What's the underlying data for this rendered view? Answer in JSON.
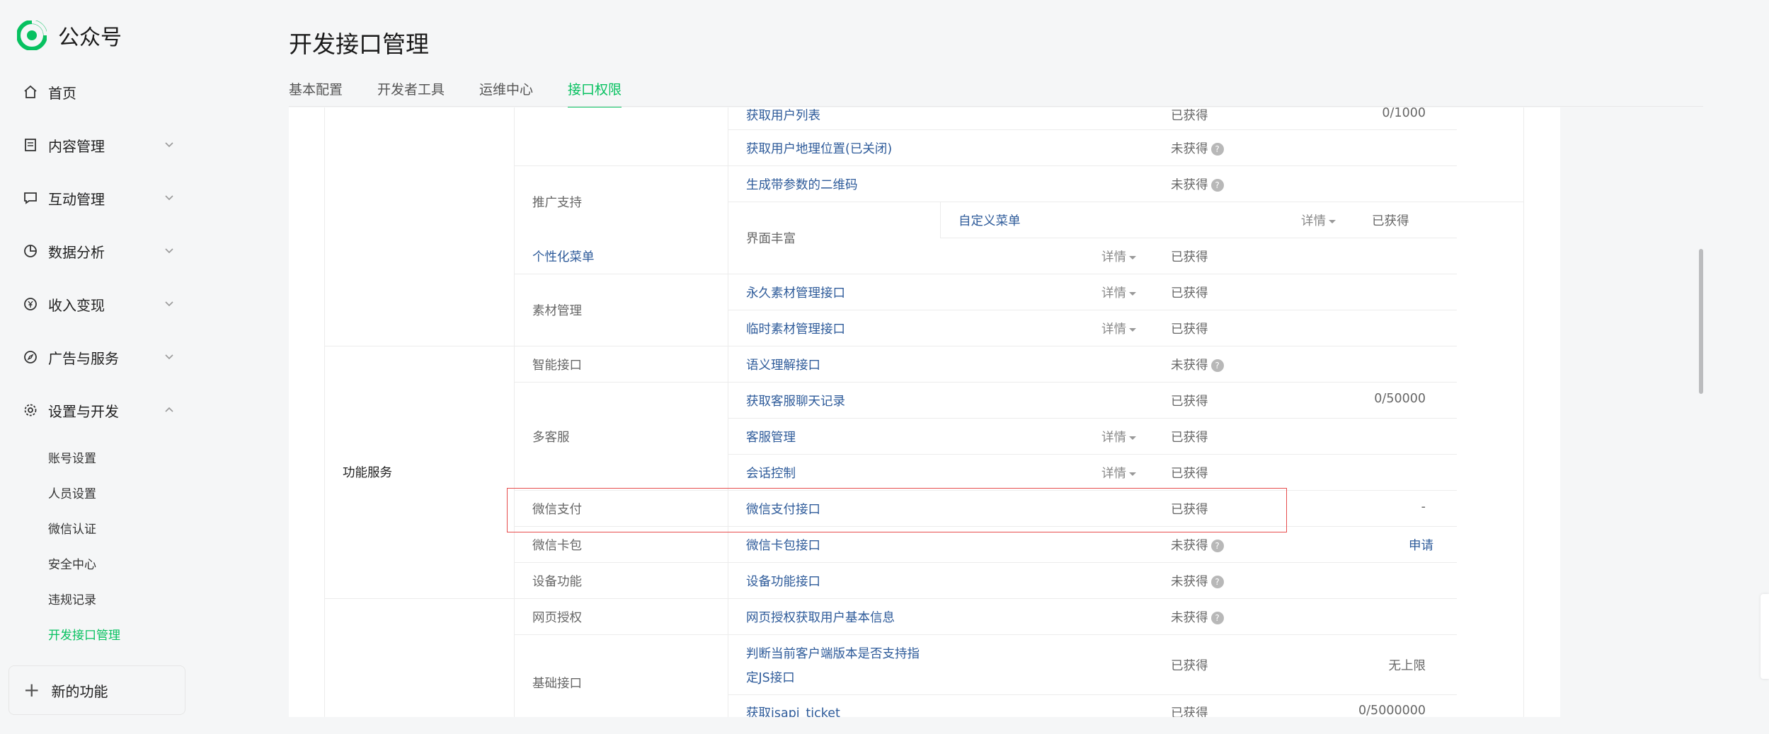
{
  "app": {
    "name": "公众号"
  },
  "sidebar": {
    "items": [
      {
        "label": "首页"
      },
      {
        "label": "内容管理"
      },
      {
        "label": "互动管理"
      },
      {
        "label": "数据分析"
      },
      {
        "label": "收入变现"
      },
      {
        "label": "广告与服务"
      },
      {
        "label": "设置与开发"
      }
    ],
    "sub_items": [
      {
        "label": "账号设置"
      },
      {
        "label": "人员设置"
      },
      {
        "label": "微信认证"
      },
      {
        "label": "安全中心"
      },
      {
        "label": "违规记录"
      },
      {
        "label": "开发接口管理"
      }
    ],
    "new_feature": "新的功能"
  },
  "header": {
    "title": "开发接口管理",
    "tabs": [
      {
        "label": "基本配置"
      },
      {
        "label": "开发者工具"
      },
      {
        "label": "运维中心"
      },
      {
        "label": "接口权限"
      }
    ]
  },
  "table": {
    "categories": {
      "function_service": "功能服务"
    },
    "rows": {
      "r1": {
        "name": "获取用户列表",
        "quota": "0/1000",
        "status": "已获得"
      },
      "r2": {
        "name": "获取用户地理位置(已关闭)",
        "status": "未获得"
      },
      "r3": {
        "group": "推广支持",
        "name": "生成带参数的二维码",
        "status": "未获得"
      },
      "r4": {
        "group": "界面丰富",
        "name": "自定义菜单",
        "detail": "详情",
        "status": "已获得"
      },
      "r5": {
        "name": "个性化菜单",
        "detail": "详情",
        "status": "已获得"
      },
      "r6": {
        "group": "素材管理",
        "name": "永久素材管理接口",
        "detail": "详情",
        "status": "已获得"
      },
      "r7": {
        "name": "临时素材管理接口",
        "detail": "详情",
        "status": "已获得"
      },
      "r8": {
        "group": "智能接口",
        "name": "语义理解接口",
        "status": "未获得"
      },
      "r9": {
        "group": "多客服",
        "name": "获取客服聊天记录",
        "quota": "0/50000",
        "status": "已获得"
      },
      "r10": {
        "name": "客服管理",
        "detail": "详情",
        "status": "已获得"
      },
      "r11": {
        "name": "会话控制",
        "detail": "详情",
        "status": "已获得"
      },
      "r12": {
        "group": "微信支付",
        "name": "微信支付接口",
        "quota": "-",
        "status": "已获得"
      },
      "r13": {
        "group": "微信卡包",
        "name": "微信卡包接口",
        "status": "未获得",
        "action": "申请"
      },
      "r14": {
        "group": "设备功能",
        "name": "设备功能接口",
        "status": "未获得"
      },
      "r15": {
        "group": "网页授权",
        "name": "网页授权获取用户基本信息",
        "status": "未获得"
      },
      "r16": {
        "group": "基础接口",
        "name_line1": "判断当前客户端版本是否支持指",
        "name_line2": "定JS接口",
        "quota": "无上限",
        "status": "已获得"
      },
      "r17": {
        "name": "获取jsapi_ticket",
        "quota": "0/5000000",
        "status": "已获得"
      }
    },
    "qmark": "?"
  },
  "colors": {
    "accent": "#07c160",
    "link": "#2e5b9a",
    "highlight": "#e74c4c"
  }
}
